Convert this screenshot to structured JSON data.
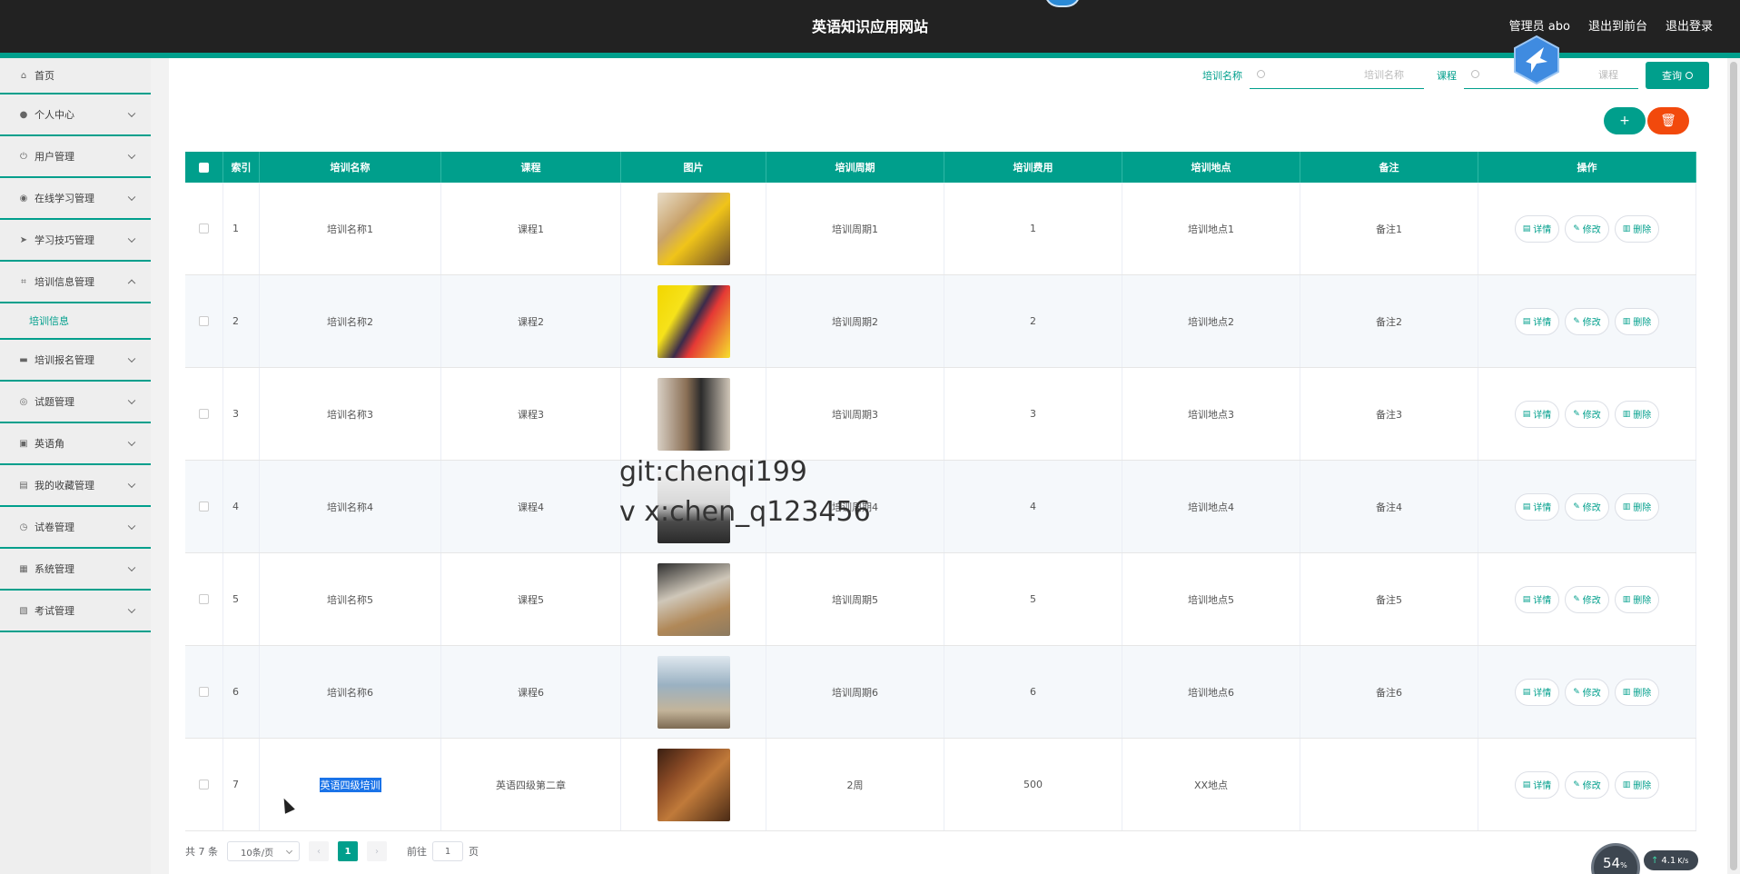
{
  "header": {
    "title": "英语知识应用网站",
    "user": "管理员 abo",
    "front_link": "退出到前台",
    "logout": "退出登录"
  },
  "sidebar": {
    "items": [
      {
        "label": "首页",
        "icon": "home-icon"
      },
      {
        "label": "个人中心",
        "icon": "user-icon"
      },
      {
        "label": "用户管理",
        "icon": "power-icon"
      },
      {
        "label": "在线学习管理",
        "icon": "compass-icon"
      },
      {
        "label": "学习技巧管理",
        "icon": "send-icon"
      },
      {
        "label": "培训信息管理",
        "icon": "crop-icon",
        "expanded": true,
        "sub": "培训信息"
      },
      {
        "label": "培训报名管理",
        "icon": "chat-icon"
      },
      {
        "label": "试题管理",
        "icon": "globe-icon"
      },
      {
        "label": "英语角",
        "icon": "briefcase-icon"
      },
      {
        "label": "我的收藏管理",
        "icon": "folder-icon"
      },
      {
        "label": "试卷管理",
        "icon": "clock-icon"
      },
      {
        "label": "系统管理",
        "icon": "clipboard-icon"
      },
      {
        "label": "考试管理",
        "icon": "clipboard-check-icon"
      }
    ]
  },
  "search": {
    "name_label": "培训名称",
    "name_placeholder": "培训名称",
    "course_label": "课程",
    "course_placeholder": "课程",
    "button": "查询"
  },
  "actions": {
    "add": "+",
    "delete": "🗑"
  },
  "table": {
    "columns": [
      "索引",
      "培训名称",
      "课程",
      "图片",
      "培训周期",
      "培训费用",
      "培训地点",
      "备注",
      "操作"
    ],
    "rows": [
      {
        "index": "1",
        "name": "培训名称1",
        "course": "课程1",
        "period": "培训周期1",
        "fee": "1",
        "place": "培训地点1",
        "note": "备注1"
      },
      {
        "index": "2",
        "name": "培训名称2",
        "course": "课程2",
        "period": "培训周期2",
        "fee": "2",
        "place": "培训地点2",
        "note": "备注2"
      },
      {
        "index": "3",
        "name": "培训名称3",
        "course": "课程3",
        "period": "培训周期3",
        "fee": "3",
        "place": "培训地点3",
        "note": "备注3"
      },
      {
        "index": "4",
        "name": "培训名称4",
        "course": "课程4",
        "period": "培训周期4",
        "fee": "4",
        "place": "培训地点4",
        "note": "备注4"
      },
      {
        "index": "5",
        "name": "培训名称5",
        "course": "课程5",
        "period": "培训周期5",
        "fee": "5",
        "place": "培训地点5",
        "note": "备注5"
      },
      {
        "index": "6",
        "name": "培训名称6",
        "course": "课程6",
        "period": "培训周期6",
        "fee": "6",
        "place": "培训地点6",
        "note": "备注6"
      },
      {
        "index": "7",
        "name": "英语四级培训",
        "course": "英语四级第二章",
        "period": "2周",
        "fee": "500",
        "place": "XX地点",
        "note": ""
      }
    ],
    "op_labels": {
      "detail": "详情",
      "edit": "修改",
      "delete": "删除"
    }
  },
  "pagination": {
    "total": "共 7 条",
    "page_size": "10条/页",
    "prev": "‹",
    "next": "›",
    "current": "1",
    "goto_label": "前往",
    "goto_value": "1",
    "page_unit": "页"
  },
  "watermark": {
    "line1": "git:chenqi199",
    "line2": "v x:chen_q123456"
  },
  "speed_widget": {
    "value": "54",
    "unit": "%",
    "rate": "4.1",
    "rate_unit": "K/s"
  },
  "colors": {
    "accent": "#009f8c",
    "header_bg": "#222222",
    "danger": "#f2490c"
  }
}
